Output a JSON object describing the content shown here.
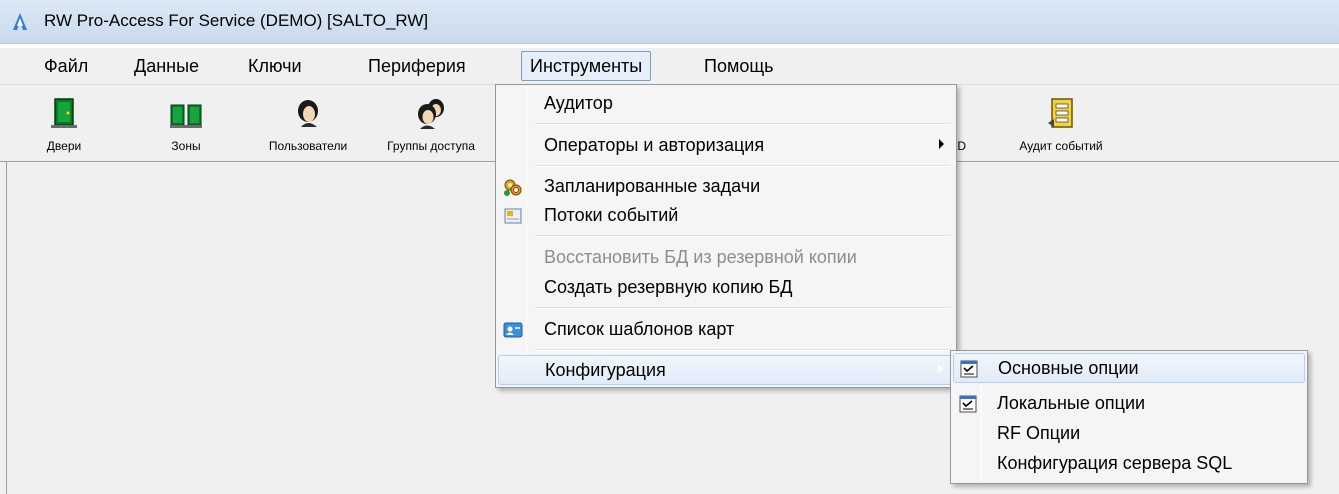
{
  "window": {
    "title": "RW Pro-Access For Service (DEMO) [SALTO_RW]",
    "icon": "rw-logo-icon"
  },
  "menubar": {
    "items": [
      {
        "label": "Файл"
      },
      {
        "label": "Данные"
      },
      {
        "label": "Ключи"
      },
      {
        "label": "Периферия"
      },
      {
        "label": "Инструменты",
        "active": true
      },
      {
        "label": "Помощь"
      }
    ]
  },
  "toolbar": {
    "buttons": [
      {
        "label": "Двери",
        "icon": "door-icon"
      },
      {
        "label": "Зоны",
        "icon": "zones-icon"
      },
      {
        "label": "Пользователи",
        "icon": "user-icon"
      },
      {
        "label": "Группы доступа",
        "icon": "access-groups-icon"
      },
      {
        "label": "D",
        "icon": "partially-hidden-icon"
      },
      {
        "label": "Аудит событий",
        "icon": "event-audit-icon"
      }
    ]
  },
  "tools_menu": {
    "items": [
      {
        "label": "Аудитор"
      },
      {
        "label": "Операторы и авторизация",
        "submenu": true
      },
      {
        "label": "Запланированные задачи",
        "icon": "scheduled-tasks-icon"
      },
      {
        "label": "Потоки событий",
        "icon": "event-stream-icon"
      },
      {
        "label": "Восстановить БД из резервной копии",
        "disabled": true
      },
      {
        "label": "Создать резервную копию БД"
      },
      {
        "label": "Список шаблонов карт",
        "icon": "card-templates-icon"
      },
      {
        "label": "Конфигурация",
        "submenu": true,
        "highlighted": true
      }
    ]
  },
  "config_submenu": {
    "items": [
      {
        "label": "Основные опции",
        "icon": "options-checklist-icon",
        "highlighted": true
      },
      {
        "label": "Локальные опции",
        "icon": "options-checklist-icon"
      },
      {
        "label": "RF Опции"
      },
      {
        "label": "Конфигурация сервера SQL"
      }
    ]
  }
}
